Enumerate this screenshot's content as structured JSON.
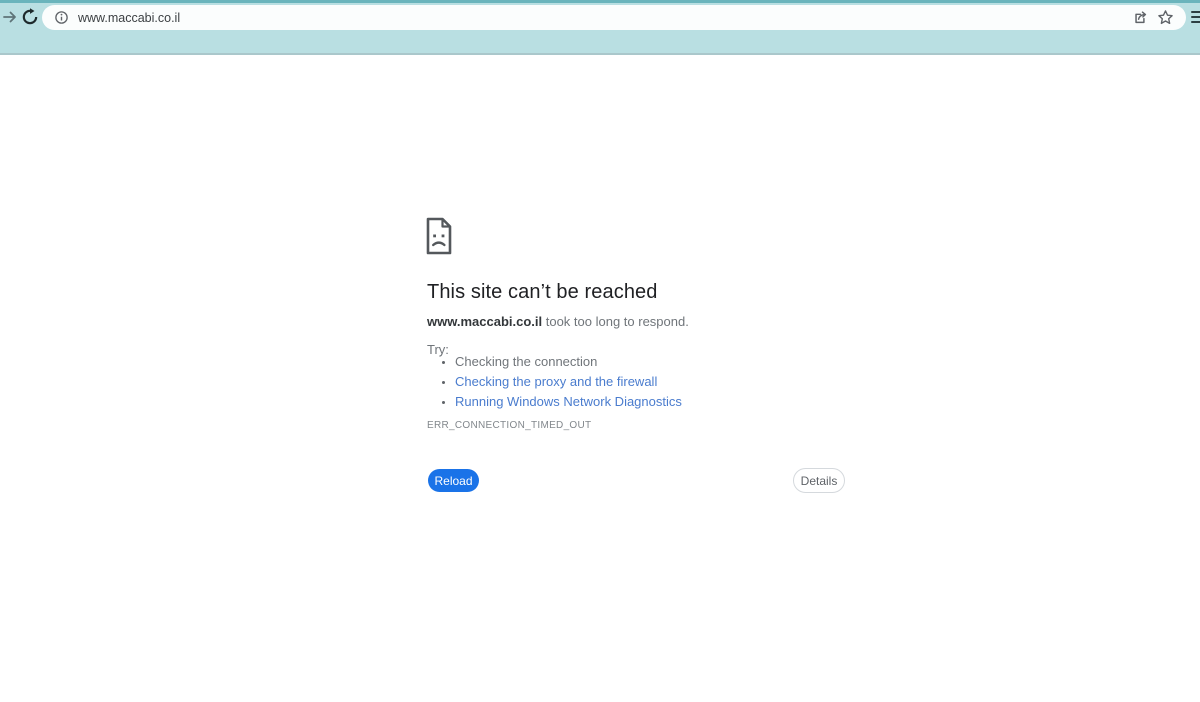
{
  "browser": {
    "url": "www.maccabi.co.il",
    "toolbar_icons": [
      "forward-icon",
      "reload-icon",
      "site-info-icon",
      "share-icon",
      "bookmark-star-icon",
      "menu-icon"
    ],
    "theme_color": "#b9dfe2",
    "theme_accent_strip": "#6ab4bc"
  },
  "error_page": {
    "title": "This site can’t be reached",
    "host": "www.maccabi.co.il",
    "message_rest": " took too long to respond.",
    "try_label": "Try:",
    "suggestions": [
      {
        "label": "Checking the connection",
        "is_link": false
      },
      {
        "label": "Checking the proxy and the firewall",
        "is_link": true
      },
      {
        "label": "Running Windows Network Diagnostics",
        "is_link": true
      }
    ],
    "error_code": "ERR_CONNECTION_TIMED_OUT",
    "reload_label": "Reload",
    "details_label": "Details",
    "sad_file_icon": "sad-file-icon"
  },
  "colors": {
    "link_blue": "#4a7cce",
    "primary_button_blue": "#1a73e8",
    "body_gray": "#70757a",
    "heading": "#202124"
  }
}
